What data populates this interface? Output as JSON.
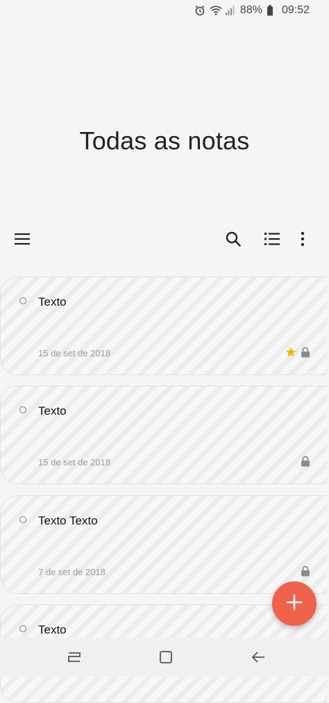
{
  "status_bar": {
    "battery": "88%",
    "time": "09:52",
    "icons": [
      "alarm-icon",
      "wifi-icon",
      "signal-icon",
      "battery-icon"
    ]
  },
  "page": {
    "title": "Todas as notas"
  },
  "toolbar": {
    "icons": [
      "menu-icon",
      "search-icon",
      "list-view-icon",
      "more-options-icon"
    ]
  },
  "notes": [
    {
      "title": "Texto",
      "date": "15 de set de 2018",
      "favorite": true,
      "locked": true
    },
    {
      "title": "Texto",
      "date": "15 de set de 2018",
      "favorite": false,
      "locked": true
    },
    {
      "title": "Texto Texto",
      "date": "7 de set de 2018",
      "favorite": false,
      "locked": true
    },
    {
      "title": "Texto",
      "date": "",
      "favorite": false,
      "locked": false
    }
  ],
  "fab": {
    "icon": "plus-icon",
    "color": "#f0624b"
  },
  "navbar": {
    "icons": [
      "recent-apps-icon",
      "home-icon",
      "back-icon"
    ]
  },
  "colors": {
    "accent": "#f0624b",
    "star": "#f2b705",
    "background": "#f5f5f5"
  }
}
